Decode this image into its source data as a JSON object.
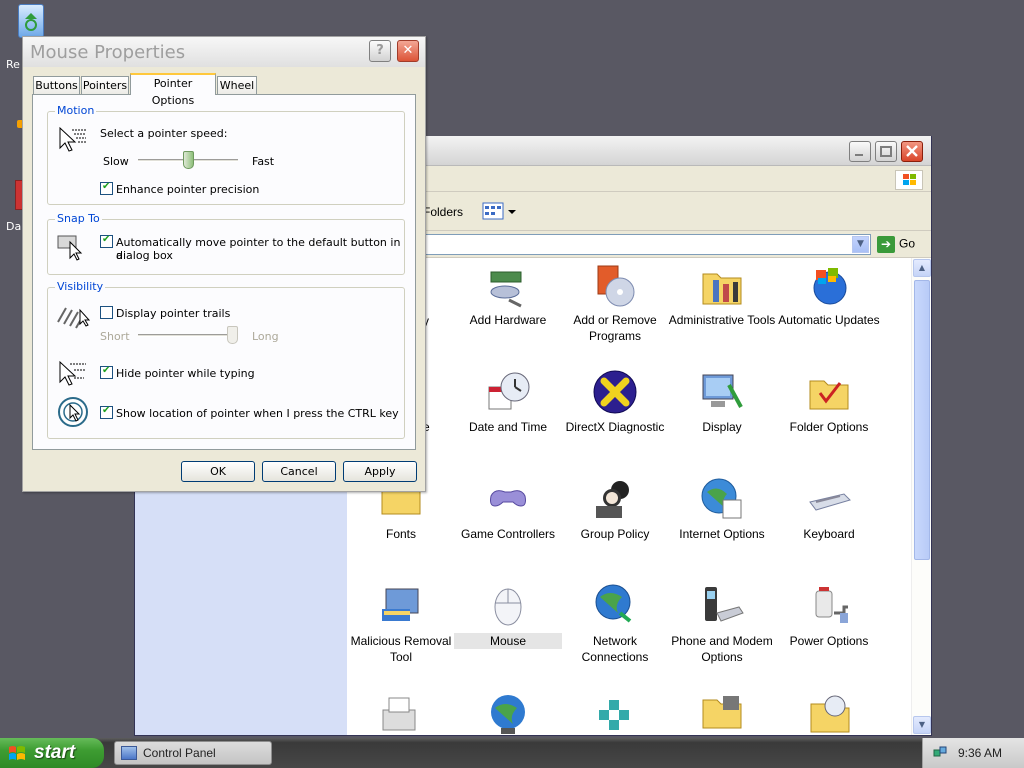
{
  "desktop": {
    "icons": [
      {
        "label": "Re",
        "name": "recycle-bin"
      },
      {
        "label": "Da",
        "name": "desktop-shortcut"
      }
    ]
  },
  "control_panel": {
    "title": "",
    "toolbar": {
      "folders_label": "Folders"
    },
    "address": {
      "go_label": "Go"
    },
    "items": [
      {
        "label": "Add Hardware",
        "icon": "add-hardware-icon"
      },
      {
        "label": "Add or Remove Programs",
        "icon": "add-remove-programs-icon"
      },
      {
        "label": "Administrative Tools",
        "icon": "administrative-tools-icon"
      },
      {
        "label": "Automatic Updates",
        "icon": "automatic-updates-icon"
      },
      {
        "label": "Date and Time",
        "icon": "date-time-icon"
      },
      {
        "label": "DirectX Diagnostic",
        "icon": "directx-icon"
      },
      {
        "label": "Display",
        "icon": "display-icon"
      },
      {
        "label": "Folder Options",
        "icon": "folder-options-icon"
      },
      {
        "label": "Fonts",
        "icon": "fonts-icon"
      },
      {
        "label": "Game Controllers",
        "icon": "game-controllers-icon"
      },
      {
        "label": "Group Policy",
        "icon": "group-policy-icon"
      },
      {
        "label": "Internet Options",
        "icon": "internet-options-icon"
      },
      {
        "label": "Keyboard",
        "icon": "keyboard-icon"
      },
      {
        "label": "Malicious Removal Tool",
        "icon": "malicious-removal-icon"
      },
      {
        "label": "Mouse",
        "icon": "mouse-icon"
      },
      {
        "label": "Network Connections",
        "icon": "network-connections-icon"
      },
      {
        "label": "Phone and Modem Options",
        "icon": "phone-modem-icon"
      },
      {
        "label": "Power Options",
        "icon": "power-options-icon"
      }
    ],
    "partial_labels": [
      "y",
      "e"
    ]
  },
  "mouse_properties": {
    "title": "Mouse Properties",
    "help_glyph": "?",
    "close_glyph": "✕",
    "tabs": [
      "Buttons",
      "Pointers",
      "Pointer Options",
      "Wheel"
    ],
    "active_tab": "Pointer Options",
    "motion": {
      "group_label": "Motion",
      "prompt": "Select a pointer speed:",
      "slow_label": "Slow",
      "fast_label": "Fast",
      "speed_level": 0.5,
      "enhance_label": "Enhance pointer precision",
      "enhance_checked": true
    },
    "snap_to": {
      "group_label": "Snap To",
      "label_line1": "Automatically move pointer to the default button in a",
      "label_line2": "dialog box",
      "checked": true
    },
    "visibility": {
      "group_label": "Visibility",
      "trails_label": "Display pointer trails",
      "trails_checked": false,
      "short_label": "Short",
      "long_label": "Long",
      "trail_level": 1.0,
      "hide_label": "Hide pointer while typing",
      "hide_checked": true,
      "ctrl_label": "Show location of pointer when I press the CTRL key",
      "ctrl_checked": true
    },
    "buttons": {
      "ok": "OK",
      "cancel": "Cancel",
      "apply": "Apply"
    }
  },
  "taskbar": {
    "start_label": "start",
    "task_label": "Control Panel",
    "clock": "9:36 AM"
  },
  "colors": {
    "desktop": "#595863",
    "group_label": "#0046d5",
    "start_green": "#3e9d32",
    "leftpane": "#d6dff7"
  }
}
